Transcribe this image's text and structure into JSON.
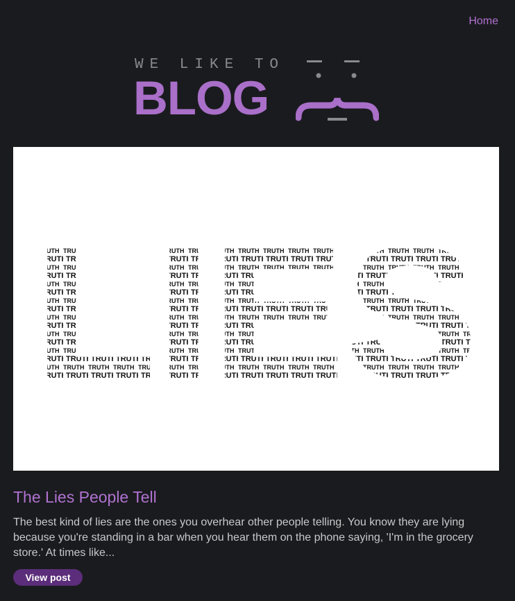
{
  "nav": {
    "home_label": "Home"
  },
  "logo": {
    "tagline": "WE LIKE TO",
    "wordmark": "BLOG",
    "icon": "curly-face-icon"
  },
  "post": {
    "image_word": "LIES",
    "image_fill_word": "TRUTH",
    "title": "The Lies People Tell",
    "excerpt": "The best kind of lies are the ones you overhear other people telling. You know they are lying because you're standing in a bar when you hear them on the phone saying, 'I'm in the grocery store.' At times like...",
    "button_label": "View post"
  },
  "colors": {
    "background": "#1a1b1e",
    "accent": "#b072d1",
    "button": "#5b2d7a",
    "text": "#c9c9cc"
  }
}
